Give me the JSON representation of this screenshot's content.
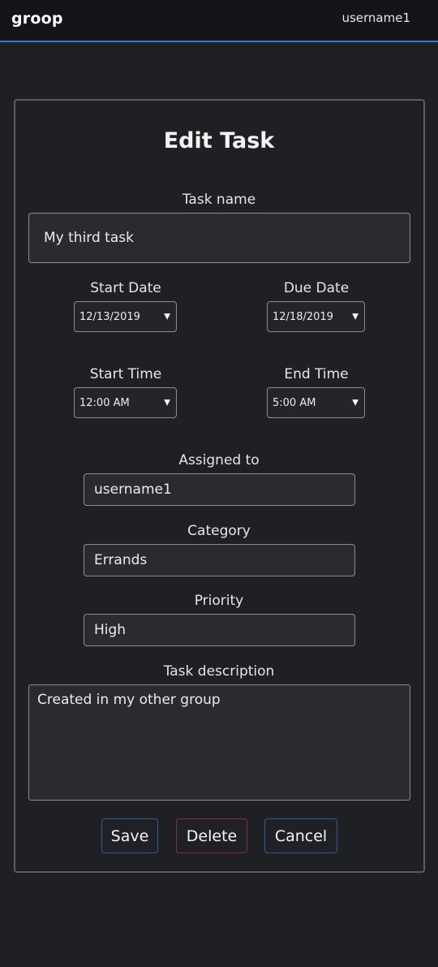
{
  "header": {
    "brand": "groop",
    "username": "username1"
  },
  "form": {
    "title": "Edit Task",
    "task_name": {
      "label": "Task name",
      "value": "My third task"
    },
    "start_date": {
      "label": "Start Date",
      "value": "12/13/2019"
    },
    "due_date": {
      "label": "Due Date",
      "value": "12/18/2019"
    },
    "start_time": {
      "label": "Start Time",
      "value": "12:00 AM"
    },
    "end_time": {
      "label": "End Time",
      "value": "5:00 AM"
    },
    "assigned_to": {
      "label": "Assigned to",
      "value": "username1"
    },
    "category": {
      "label": "Category",
      "value": "Errands"
    },
    "priority": {
      "label": "Priority",
      "value": "High"
    },
    "description": {
      "label": "Task description",
      "value": "Created in my other group"
    }
  },
  "actions": {
    "save": "Save",
    "delete": "Delete",
    "cancel": "Cancel"
  },
  "icons": {
    "dropdown_caret": "chevron-down-icon",
    "caret_glyph": "▼"
  },
  "colors": {
    "background": "#1f2024",
    "topbar": "#141518",
    "topbar_accent": "#3a78c9",
    "button_primary_border": "#2f5b95",
    "button_danger_border": "#8a2e32"
  }
}
